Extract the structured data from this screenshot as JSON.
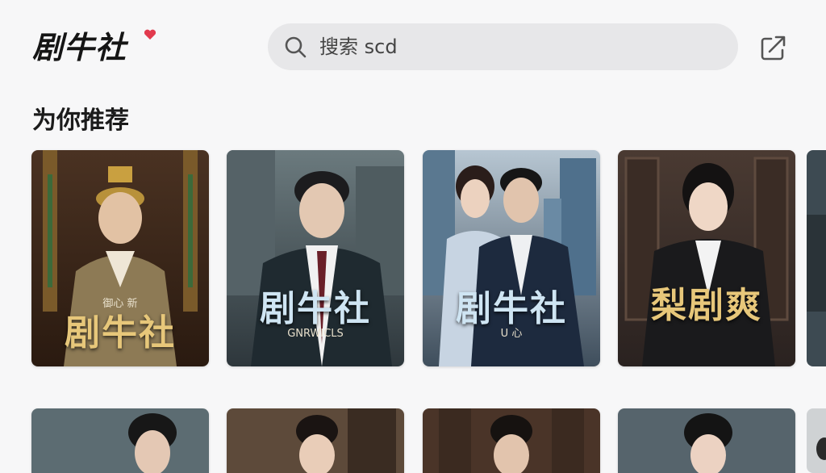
{
  "app": {
    "logo_text": "剧牛社"
  },
  "search": {
    "text": "搜索 scd"
  },
  "section": {
    "title": "为你推荐"
  },
  "cards_row1": [
    {
      "title": "剧牛社",
      "subtitle": "御心 新"
    },
    {
      "title": "剧牛社",
      "subtitle": "GNRWICLS"
    },
    {
      "title": "剧牛社",
      "subtitle": "U 心"
    },
    {
      "title": "梨剧爽",
      "subtitle": ""
    }
  ],
  "colors": {
    "accent_heart": "#e23a4e",
    "background": "#f7f7f8",
    "search_bg": "#e7e7e9"
  },
  "icons": [
    "search-icon",
    "share-icon",
    "heart-icon"
  ]
}
